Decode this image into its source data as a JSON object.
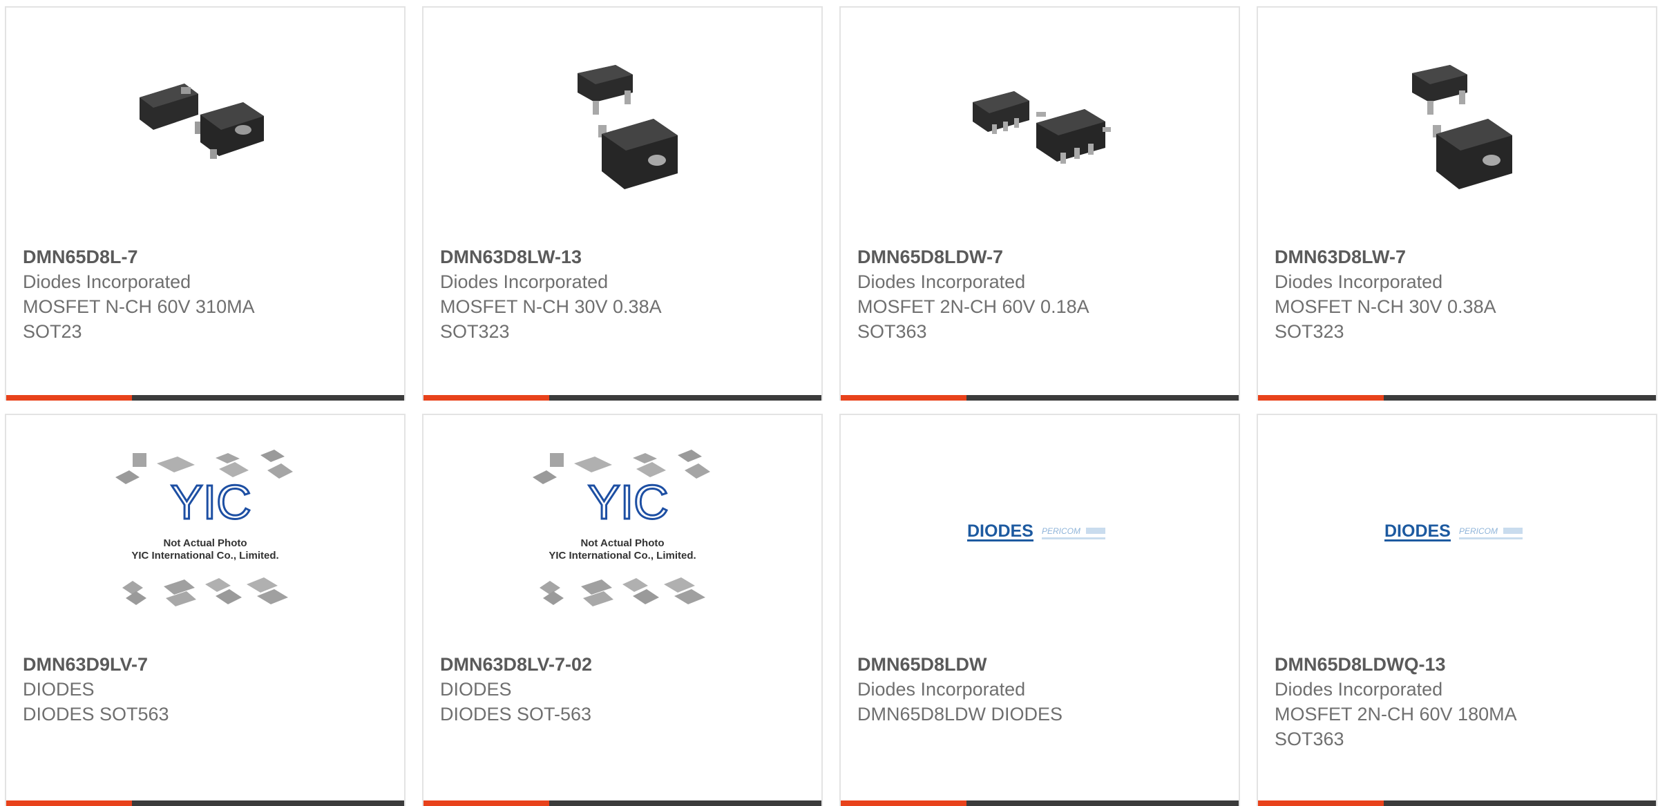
{
  "colors": {
    "accent": "#e8421b",
    "bar": "#3b3b3b",
    "border": "#e3e3e3",
    "title": "#5a5a5a",
    "text": "#6f6f6f",
    "diodes_blue": "#1d5aa0"
  },
  "cards": [
    {
      "part_number": "DMN65D8L-7",
      "manufacturer": "Diodes Incorporated",
      "desc_line1": "MOSFET N-CH 60V 310MA",
      "desc_line2": "SOT23",
      "image_icon": "sot23-package-icon"
    },
    {
      "part_number": "DMN63D8LW-13",
      "manufacturer": "Diodes Incorporated",
      "desc_line1": "MOSFET N-CH 30V 0.38A",
      "desc_line2": "SOT323",
      "image_icon": "sot323-package-icon"
    },
    {
      "part_number": "DMN65D8LDW-7",
      "manufacturer": "Diodes Incorporated",
      "desc_line1": "MOSFET 2N-CH 60V 0.18A",
      "desc_line2": "SOT363",
      "image_icon": "sot363-package-icon"
    },
    {
      "part_number": "DMN63D8LW-7",
      "manufacturer": "Diodes Incorporated",
      "desc_line1": "MOSFET N-CH 30V 0.38A",
      "desc_line2": "SOT323",
      "image_icon": "sot323-package-icon"
    },
    {
      "part_number": "DMN63D9LV-7",
      "manufacturer": "DIODES",
      "desc_line1": "DIODES SOT563",
      "desc_line2": "",
      "image_icon": "yic-placeholder-image",
      "placeholder_line1": "Not Actual Photo",
      "placeholder_line2": "YIC International Co., Limited."
    },
    {
      "part_number": "DMN63D8LV-7-02",
      "manufacturer": "DIODES",
      "desc_line1": "DIODES SOT-563",
      "desc_line2": "",
      "image_icon": "yic-placeholder-image",
      "placeholder_line1": "Not Actual Photo",
      "placeholder_line2": "YIC International Co., Limited."
    },
    {
      "part_number": "DMN65D8LDW",
      "manufacturer": "Diodes Incorporated",
      "desc_line1": "DMN65D8LDW DIODES",
      "desc_line2": "",
      "image_icon": "diodes-pericom-logo",
      "logo_text1": "DIODES",
      "logo_text2": "PERICOM"
    },
    {
      "part_number": "DMN65D8LDWQ-13",
      "manufacturer": "Diodes Incorporated",
      "desc_line1": "MOSFET 2N-CH 60V 180MA",
      "desc_line2": "SOT363",
      "image_icon": "diodes-pericom-logo",
      "logo_text1": "DIODES",
      "logo_text2": "PERICOM"
    }
  ]
}
